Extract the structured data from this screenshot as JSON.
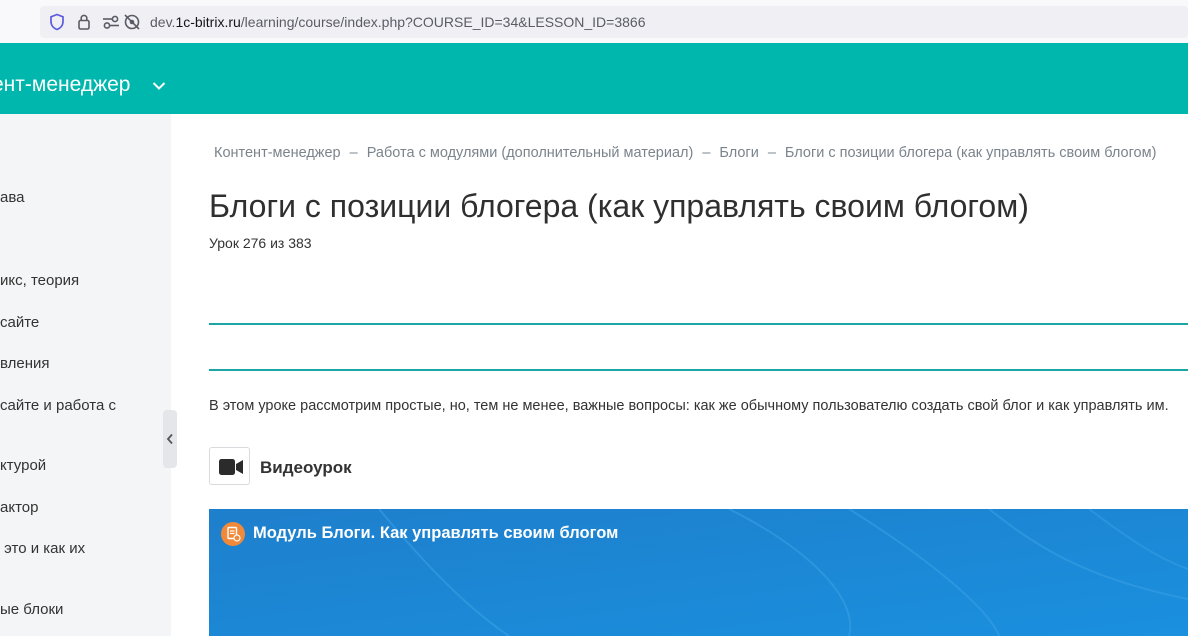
{
  "browser": {
    "url_prefix": "dev.",
    "url_host": "1c-bitrix.ru",
    "url_path": "/learning/course/index.php?COURSE_ID=34&LESSON_ID=3866"
  },
  "header": {
    "course_title": "ент-менеджер"
  },
  "sidebar": {
    "items": [
      {
        "label": "ава"
      },
      {
        "label": "икс, теория"
      },
      {
        "label": "сайте"
      },
      {
        "label": "вления"
      },
      {
        "label": "сайте и работа с"
      },
      {
        "label": "ктурой"
      },
      {
        "label": "актор"
      },
      {
        "label": " это и как их"
      },
      {
        "label": "ые блоки"
      }
    ]
  },
  "breadcrumb": {
    "items": [
      "Контент-менеджер",
      "Работа с модулями (дополнительный материал)",
      "Блоги",
      "Блоги с позиции блогера (как управлять своим блогом)"
    ],
    "separator": "–"
  },
  "lesson": {
    "title": "Блоги с позиции блогера (как управлять своим блогом)",
    "counter": "Урок 276 из 383",
    "intro": "В этом уроке рассмотрим простые, но, тем не менее, важные вопросы: как же обычному пользователю создать свой блог и как управлять им.",
    "video_heading": "Видеоурок",
    "video_title": "Модуль Блоги. Как управлять своим блогом"
  },
  "colors": {
    "header": "#00b7ae",
    "rule": "#1ba5a5",
    "video": "#1c8ad6"
  }
}
